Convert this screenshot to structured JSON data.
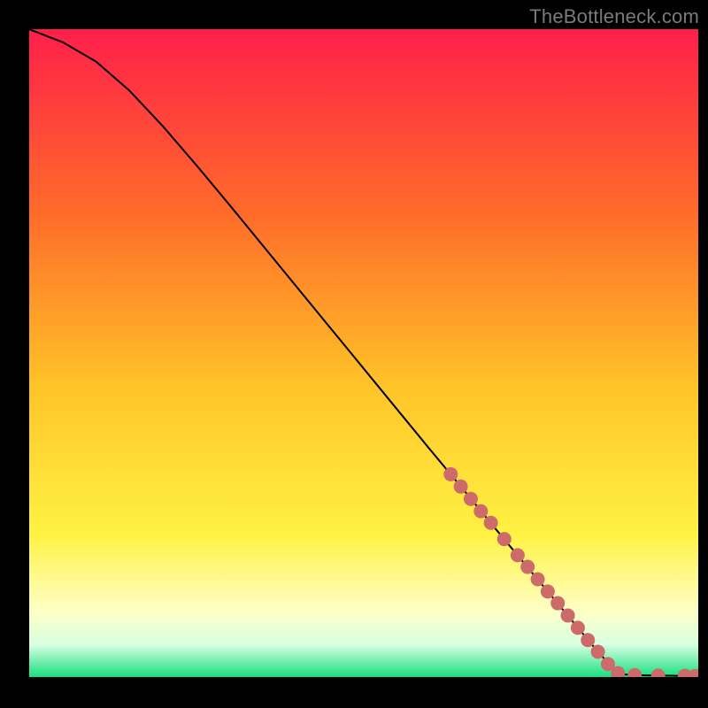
{
  "watermark": "TheBottleneck.com",
  "colors": {
    "gradient_top": "#ff1f4b",
    "gradient_mid1": "#ff6a2a",
    "gradient_mid2": "#ffc328",
    "gradient_mid3": "#fff243",
    "gradient_mid4": "#fdffc7",
    "gradient_bottom_pale": "#d8ffe2",
    "gradient_bottom_green": "#18e07e",
    "curve": "#000000",
    "marker_fill": "#cd6a6a",
    "marker_stroke": "#b85a5a"
  },
  "chart_data": {
    "type": "line",
    "title": "",
    "xlabel": "",
    "ylabel": "",
    "xlim": [
      0,
      100
    ],
    "ylim": [
      0,
      100
    ],
    "series": [
      {
        "name": "curve",
        "x": [
          0,
          5,
          10,
          15,
          20,
          25,
          30,
          35,
          40,
          45,
          50,
          55,
          60,
          65,
          70,
          75,
          80,
          85,
          88,
          90,
          92,
          94,
          96,
          98,
          100
        ],
        "y": [
          100,
          98,
          95,
          90.5,
          85,
          79,
          72.8,
          66.5,
          60.2,
          53.9,
          47.6,
          41.3,
          35,
          28.8,
          22.5,
          16.3,
          10.1,
          3.9,
          0.5,
          0.3,
          0.25,
          0.22,
          0.2,
          0.18,
          0.15
        ]
      }
    ],
    "markers": {
      "name": "highlighted-segment",
      "x": [
        63,
        64.5,
        66,
        67.5,
        69,
        71,
        73,
        74.5,
        76,
        77.5,
        79,
        80.5,
        82,
        83.5,
        85,
        86.5,
        88,
        90.5,
        94,
        98,
        99.5
      ],
      "y": [
        31.3,
        29.4,
        27.5,
        25.6,
        23.8,
        21.3,
        18.8,
        17,
        15.1,
        13.2,
        11.4,
        9.5,
        7.6,
        5.7,
        3.9,
        2,
        0.6,
        0.3,
        0.22,
        0.18,
        0.16
      ]
    }
  }
}
